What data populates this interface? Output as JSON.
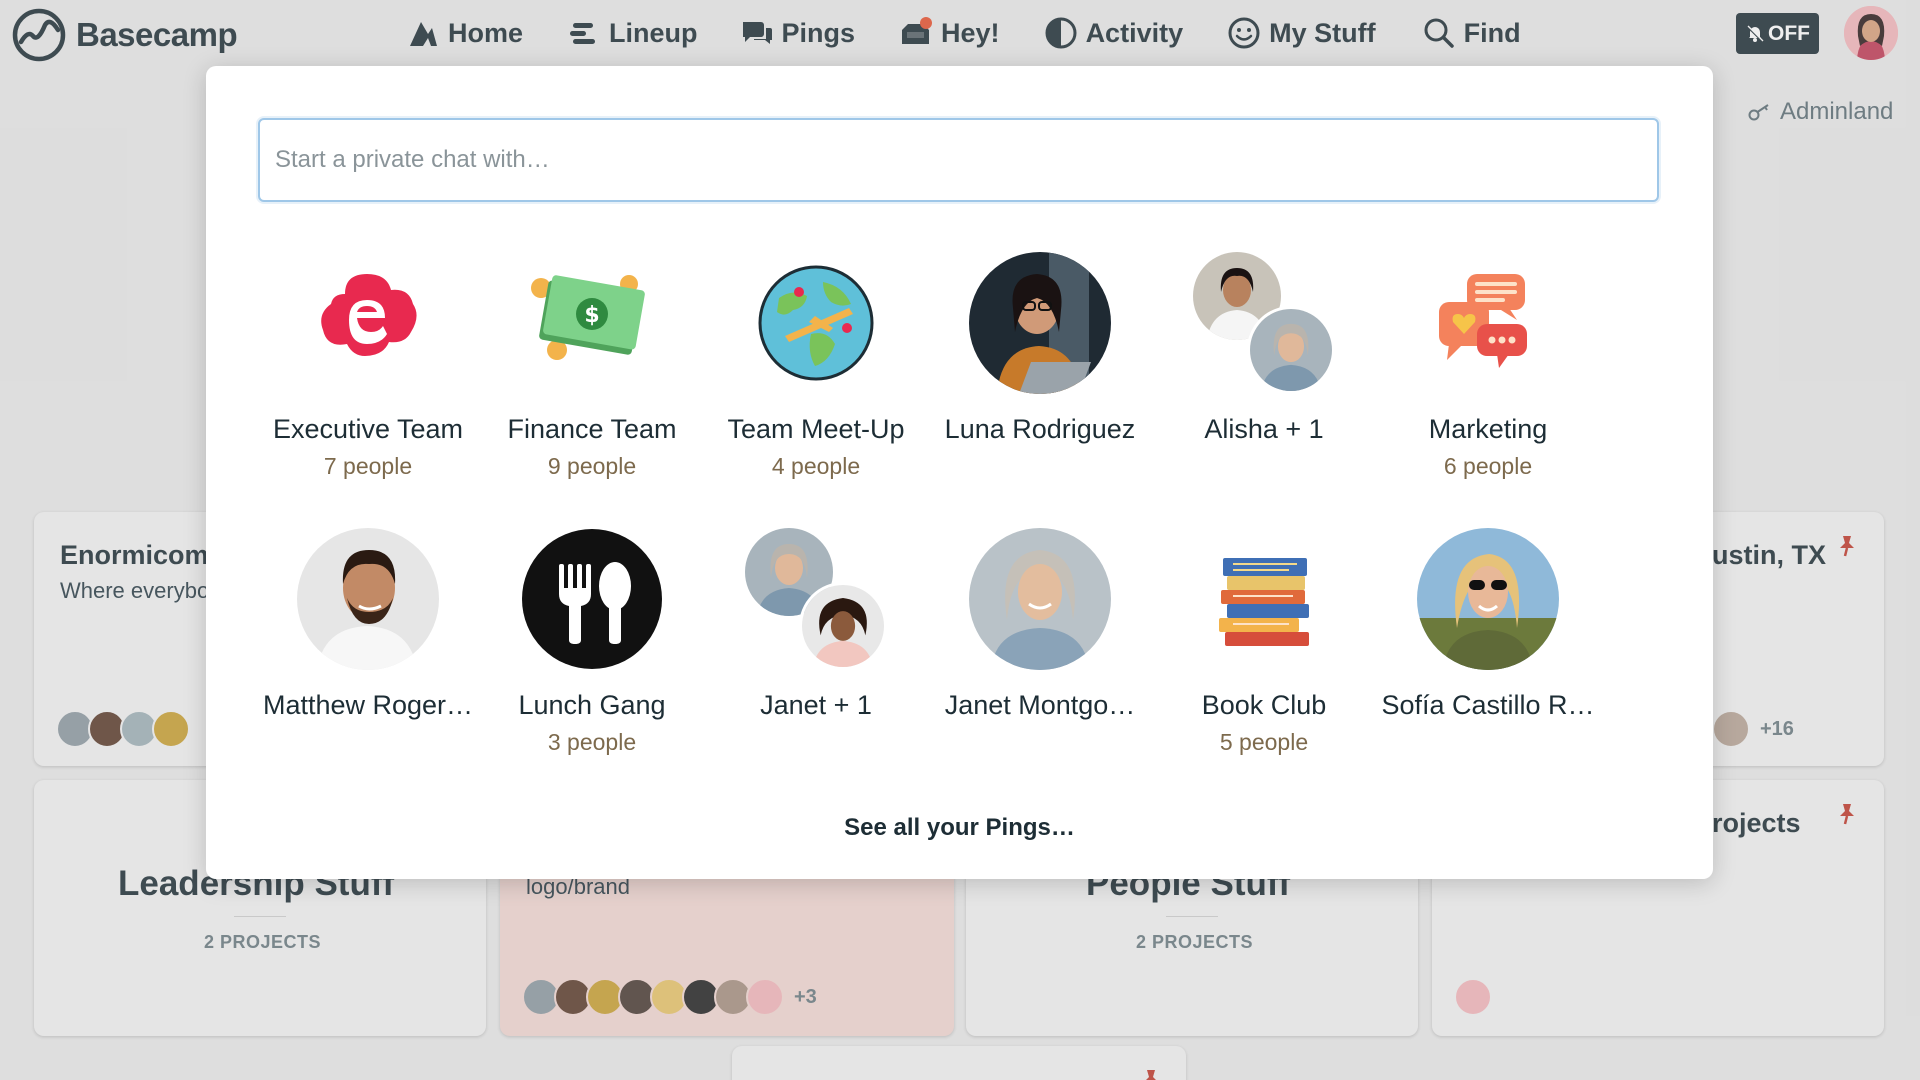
{
  "app": {
    "name": "Basecamp"
  },
  "nav": {
    "home": "Home",
    "lineup": "Lineup",
    "pings": "Pings",
    "hey": "Hey!",
    "activity": "Activity",
    "mystuff": "My Stuff",
    "find": "Find",
    "notifications_toggle": "OFF"
  },
  "adminland": "Adminland",
  "background_cards": {
    "enormicom": {
      "title": "Enormicom",
      "subtitle": "Where everybo"
    },
    "austin": {
      "title": "ustin, TX",
      "more": "+16"
    },
    "leadership": {
      "title": "Leadership Stuff",
      "count": "2 PROJECTS"
    },
    "logo_brand": {
      "subtitle": "logo/brand",
      "more": "+3"
    },
    "people": {
      "title": "People Stuff",
      "count": "2 PROJECTS"
    },
    "projects": {
      "title": "rojects"
    }
  },
  "modal": {
    "search_placeholder": "Start a private chat with…",
    "see_all": "See all your Pings…",
    "pings": [
      {
        "name": "Executive Team",
        "count": "7 people",
        "icon": "letter-e-icon"
      },
      {
        "name": "Finance Team",
        "count": "9 people",
        "icon": "money-icon"
      },
      {
        "name": "Team Meet-Up",
        "count": "4 people",
        "icon": "globe-plane-icon"
      },
      {
        "name": "Luna Rodriguez",
        "count": "",
        "icon": "avatar"
      },
      {
        "name": "Alisha + 1",
        "count": "",
        "icon": "avatar-pair"
      },
      {
        "name": "Marketing",
        "count": "6 people",
        "icon": "chat-bubbles-icon"
      },
      {
        "name": "Matthew Roger…",
        "count": "",
        "icon": "avatar"
      },
      {
        "name": "Lunch Gang",
        "count": "3 people",
        "icon": "fork-spoon-icon"
      },
      {
        "name": "Janet + 1",
        "count": "",
        "icon": "avatar-pair"
      },
      {
        "name": "Janet Montgo…",
        "count": "",
        "icon": "avatar"
      },
      {
        "name": "Book Club",
        "count": "5 people",
        "icon": "books-icon"
      },
      {
        "name": "Sofía Castillo R…",
        "count": "",
        "icon": "avatar"
      }
    ]
  },
  "colors": {
    "brand_dark": "#1d2d35",
    "accent_red": "#e8294f",
    "pin_red": "#c0392b",
    "count_brown": "#7d6a4d"
  }
}
